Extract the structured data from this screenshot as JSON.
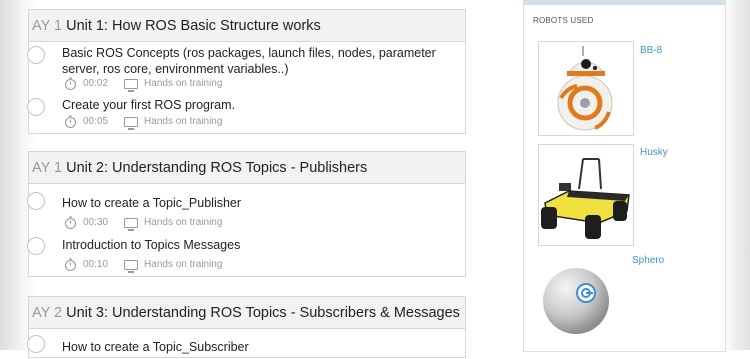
{
  "units": [
    {
      "day": "AY 1",
      "title": "Unit 1: How ROS Basic Structure works",
      "lessons": [
        {
          "title": "Basic ROS Concepts (ros packages, launch files, nodes, parameter server, ros core, environment variables..)",
          "time": "00:02",
          "type": "Hands on training"
        },
        {
          "title": "Create your first ROS program.",
          "time": "00:05",
          "type": "Hands on training"
        }
      ]
    },
    {
      "day": "AY 1",
      "title": "Unit 2: Understanding ROS Topics - Publishers",
      "lessons": [
        {
          "title": "How to create a Topic_Publisher",
          "time": "00:30",
          "type": "Hands on training"
        },
        {
          "title": "Introduction to Topics Messages",
          "time": "00:10",
          "type": "Hands on training"
        }
      ]
    },
    {
      "day": "AY 2",
      "title": "Unit 3: Understanding ROS Topics - Subscribers & Messages",
      "lessons": [
        {
          "title": "How to create a Topic_Subscriber",
          "time": "",
          "type": ""
        }
      ]
    }
  ],
  "sidebar": {
    "title": "ROBOTS USED",
    "robots": [
      {
        "name": "BB-8"
      },
      {
        "name": "Husky"
      },
      {
        "name": "Sphero"
      }
    ]
  },
  "colors": {
    "link": "#4a90c8",
    "header_bg": "#f2f2f2",
    "accent_bar": "#c9e3f2"
  }
}
